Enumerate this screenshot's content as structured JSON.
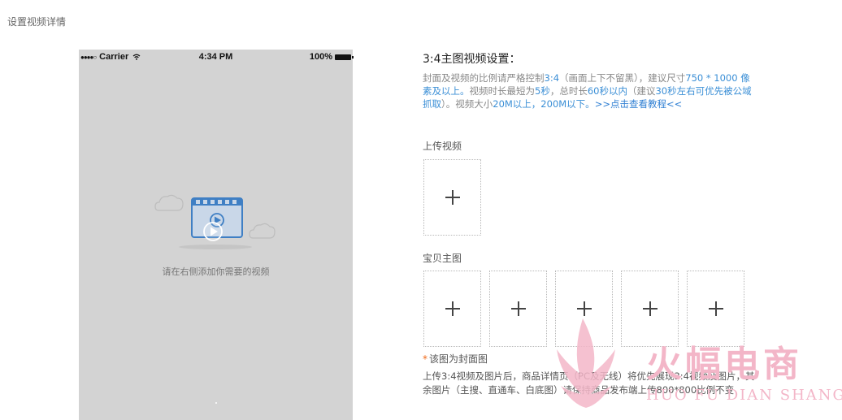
{
  "page": {
    "title": "设置视频详情"
  },
  "phone": {
    "status": {
      "carrier": "Carrier",
      "time": "4:34 PM",
      "battery": "100%"
    },
    "hint": "请在右侧添加你需要的视频"
  },
  "settings": {
    "title": "3:4主图视频设置：",
    "desc": {
      "p1": "封面及视频的比例请严格控制",
      "ratio": "3:4",
      "p2": "（画面上下不留黑），建议尺寸",
      "size": "750 * 1000 像素及以上。",
      "p3": "视频时长最短为",
      "min_len": "5秒",
      "p4": "，总时长",
      "max_len": "60秒以内",
      "p5": "（建议",
      "suggest": "30秒左右可优先被公域抓取",
      "p6": "）。视频大小",
      "file_size": "20M以上，200M以下。",
      "tutorial": ">>点击查看教程<<"
    },
    "upload_video_label": "上传视频",
    "main_images_label": "宝贝主图",
    "cover_note_star": "*",
    "cover_note": "该图为封面图",
    "sync_desc": "上传3:4视频及图片后，商品详情页（PC及无线）将优先展现3:4视频及图片，其余图片（主搜、直通车、白底图）请保持商品发布端上传800*800比例不变"
  },
  "watermark": {
    "text": "火幅电商",
    "sub": "HUO FU DIAN SHANG"
  },
  "colors": {
    "highlight": "#3b8fd6",
    "required_star": "#f06a1a",
    "phone_bg": "#d3d3d3",
    "watermark": "#f3b6c8"
  }
}
